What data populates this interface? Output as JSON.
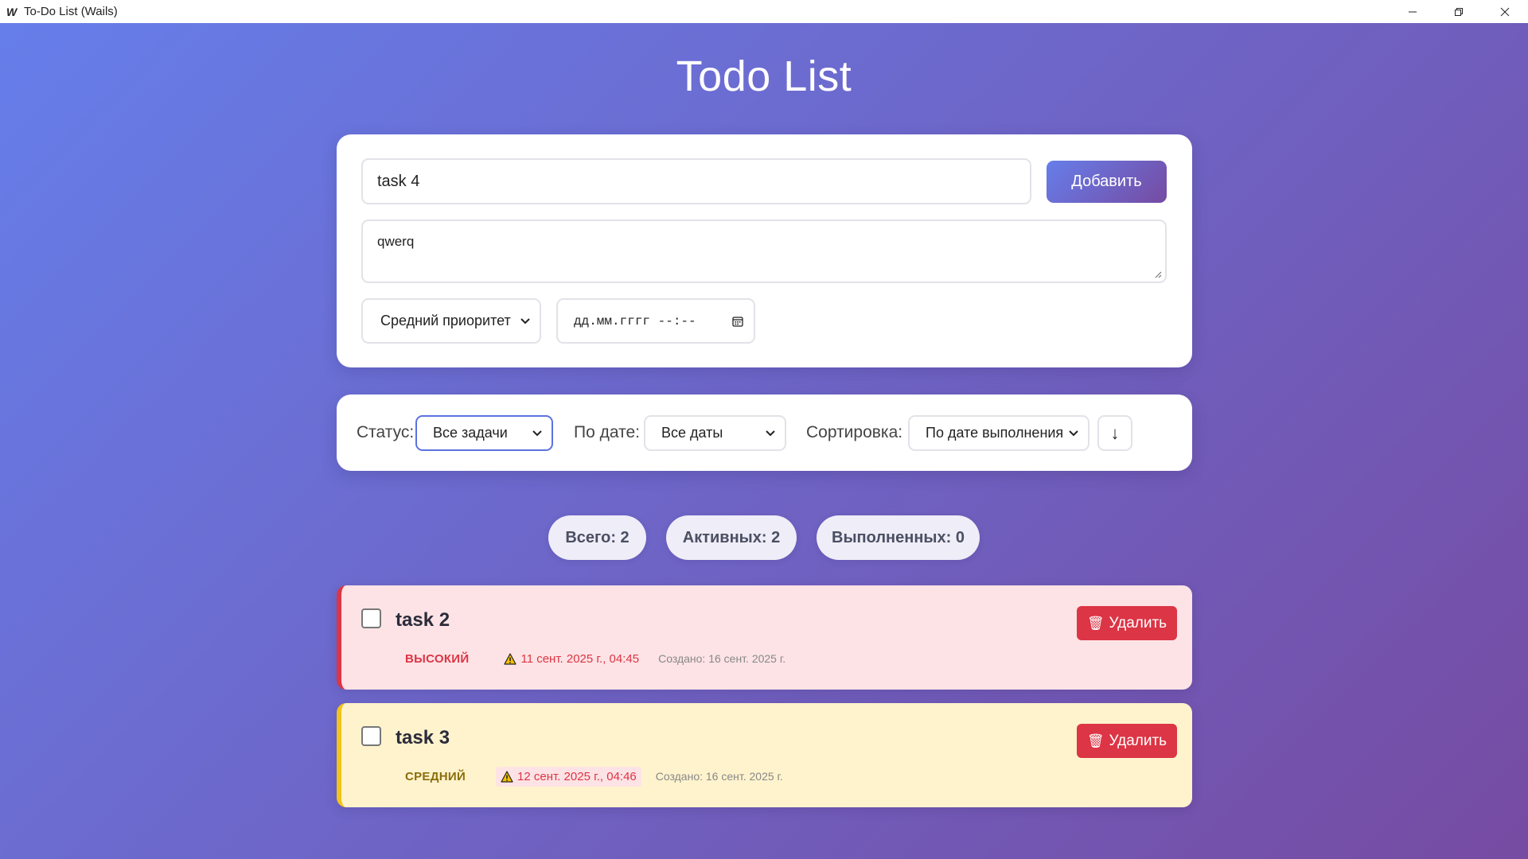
{
  "window": {
    "logo": "W",
    "title": "To-Do List (Wails)"
  },
  "page": {
    "title": "Todo List"
  },
  "form": {
    "title_value": "task 4",
    "add_label": "Добавить",
    "description_value": "qwerq",
    "priority_selected": "Средний приоритет",
    "due_date_placeholder": "дд.мм.гггг --:--"
  },
  "filters": {
    "status_label": "Статус:",
    "status_selected": "Все задачи",
    "date_label": "По дате:",
    "date_selected": "Все даты",
    "sort_label": "Сортировка:",
    "sort_selected": "По дате выполнения",
    "sort_direction": "↓"
  },
  "stats": {
    "total": "Всего: 2",
    "active": "Активных: 2",
    "done": "Выполненных: 0"
  },
  "tasks": [
    {
      "title": "task 2",
      "priority": "ВЫСОКИЙ",
      "due": "11 сент. 2025 г., 04:45",
      "created": "Создано: 16 сент. 2025 г.",
      "delete_label": "Удалить",
      "completed": false
    },
    {
      "title": "task 3",
      "priority": "СРЕДНИЙ",
      "due": "12 сент. 2025 г., 04:46",
      "created": "Создано: 16 сент. 2025 г.",
      "delete_label": "Удалить",
      "completed": false
    }
  ],
  "icons": {
    "warning": "warning-icon",
    "trash": "trash-icon",
    "calendar": "calendar-icon",
    "chevron": "chevron-down-icon"
  },
  "colors": {
    "gradient_start": "#667eea",
    "gradient_end": "#764ba2",
    "danger": "#dc3545",
    "high_bg": "#fde3e5",
    "medium_bg": "#fff3cd",
    "medium_border": "#f0c419"
  }
}
